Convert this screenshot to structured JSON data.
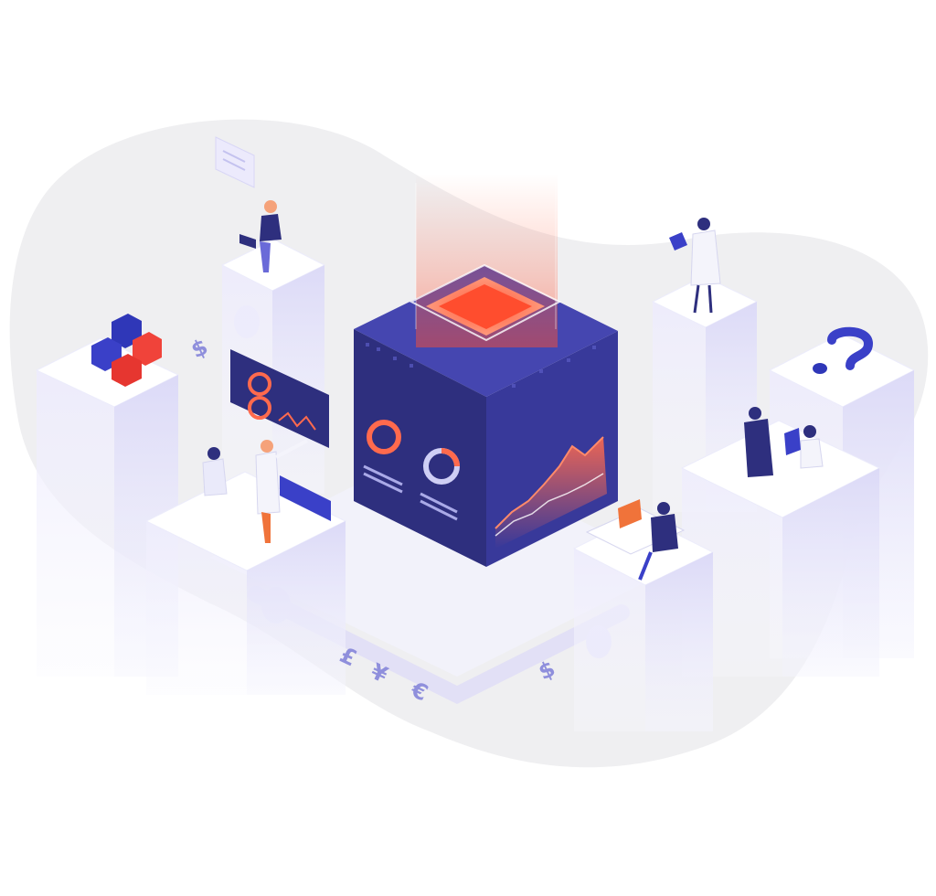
{
  "scene": {
    "kind": "isometric-illustration",
    "palette": {
      "background": "#ffffff",
      "blob": "#efeff1",
      "platform_top": "#ffffff",
      "platform_side": "#e9e8fb",
      "platform_shadow": "#d7d6f6",
      "cube_dark": "#2e2f7e",
      "cube_mid": "#38399a",
      "cube_light": "#4546b0",
      "beam_orange": "#ff6a4d",
      "accent_blue": "#3a40c8",
      "accent_red": "#f0433a",
      "glyph_color": "#8f8fdc"
    },
    "icons": [
      "data-cube-icon",
      "glowing-hologram-icon",
      "dashboard-screen-icon",
      "chat-bubble-icon",
      "question-mark-icon",
      "building-blocks-icon",
      "person-laptop-icon",
      "person-tablet-icon",
      "person-presenting-icon",
      "person-desk-icon"
    ],
    "currency_glyphs": {
      "dollar_left": "$",
      "pound": "£",
      "yen": "¥",
      "euro": "€",
      "dollar_right": "$"
    }
  }
}
